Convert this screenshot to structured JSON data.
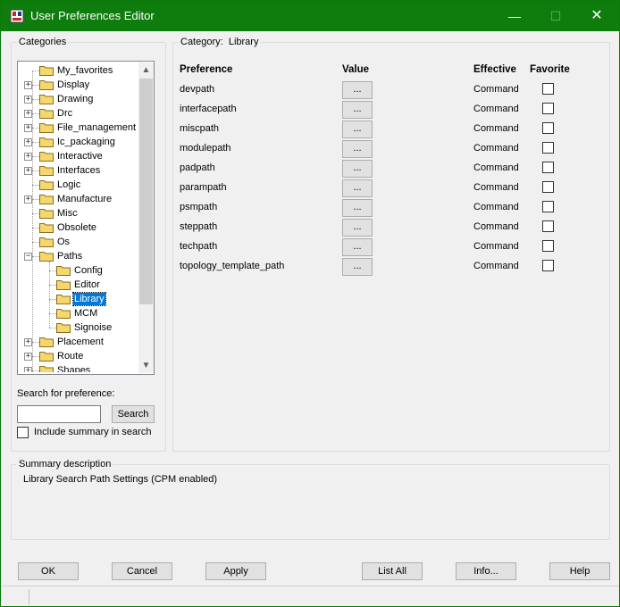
{
  "window": {
    "title": "User Preferences Editor",
    "minimize": "—",
    "maximize": "☐",
    "close": "✕"
  },
  "categories": {
    "group_label": "Categories",
    "items": [
      {
        "label": "My_favorites",
        "expandable": false,
        "level": 0
      },
      {
        "label": "Display",
        "expandable": true,
        "level": 0
      },
      {
        "label": "Drawing",
        "expandable": true,
        "level": 0
      },
      {
        "label": "Drc",
        "expandable": true,
        "level": 0
      },
      {
        "label": "File_management",
        "expandable": true,
        "level": 0
      },
      {
        "label": "Ic_packaging",
        "expandable": true,
        "level": 0
      },
      {
        "label": "Interactive",
        "expandable": true,
        "level": 0
      },
      {
        "label": "Interfaces",
        "expandable": true,
        "level": 0
      },
      {
        "label": "Logic",
        "expandable": false,
        "level": 0
      },
      {
        "label": "Manufacture",
        "expandable": true,
        "level": 0
      },
      {
        "label": "Misc",
        "expandable": false,
        "level": 0
      },
      {
        "label": "Obsolete",
        "expandable": false,
        "level": 0
      },
      {
        "label": "Os",
        "expandable": false,
        "level": 0
      },
      {
        "label": "Paths",
        "expandable": true,
        "expanded": true,
        "level": 0
      },
      {
        "label": "Config",
        "expandable": false,
        "level": 1
      },
      {
        "label": "Editor",
        "expandable": false,
        "level": 1
      },
      {
        "label": "Library",
        "expandable": false,
        "level": 1,
        "selected": true
      },
      {
        "label": "MCM",
        "expandable": false,
        "level": 1
      },
      {
        "label": "Signoise",
        "expandable": false,
        "level": 1
      },
      {
        "label": "Placement",
        "expandable": true,
        "level": 0
      },
      {
        "label": "Route",
        "expandable": true,
        "level": 0
      },
      {
        "label": "Shapes",
        "expandable": true,
        "level": 0
      }
    ]
  },
  "search": {
    "label": "Search for preference:",
    "value": "",
    "button": "Search",
    "include_summary_label": "Include summary in search",
    "include_summary_checked": false
  },
  "category_panel": {
    "label": "Category:",
    "name": "Library",
    "columns": {
      "preference": "Preference",
      "value": "Value",
      "effective": "Effective",
      "favorite": "Favorite"
    },
    "rows": [
      {
        "name": "devpath",
        "value_button": "...",
        "effective": "Command",
        "favorite": false
      },
      {
        "name": "interfacepath",
        "value_button": "...",
        "effective": "Command",
        "favorite": false
      },
      {
        "name": "miscpath",
        "value_button": "...",
        "effective": "Command",
        "favorite": false
      },
      {
        "name": "modulepath",
        "value_button": "...",
        "effective": "Command",
        "favorite": false
      },
      {
        "name": "padpath",
        "value_button": "...",
        "effective": "Command",
        "favorite": false
      },
      {
        "name": "parampath",
        "value_button": "...",
        "effective": "Command",
        "favorite": false
      },
      {
        "name": "psmpath",
        "value_button": "...",
        "effective": "Command",
        "favorite": false
      },
      {
        "name": "steppath",
        "value_button": "...",
        "effective": "Command",
        "favorite": false
      },
      {
        "name": "techpath",
        "value_button": "...",
        "effective": "Command",
        "favorite": false
      },
      {
        "name": "topology_template_path",
        "value_button": "...",
        "effective": "Command",
        "favorite": false
      }
    ]
  },
  "summary": {
    "group_label": "Summary description",
    "text": "Library Search Path Settings (CPM enabled)"
  },
  "buttons": {
    "ok": "OK",
    "cancel": "Cancel",
    "apply": "Apply",
    "list_all": "List All",
    "info": "Info...",
    "help": "Help"
  },
  "colors": {
    "titlebar": "#0e7d0e",
    "selection": "#0078d7",
    "folder": "#f5d76e"
  },
  "icons": {
    "app": "app-logo-icon",
    "folder": "folder-icon",
    "expand": "plus-expander-icon",
    "collapse": "minus-expander-icon",
    "scroll_up": "chevron-up-icon",
    "scroll_down": "chevron-down-icon"
  }
}
